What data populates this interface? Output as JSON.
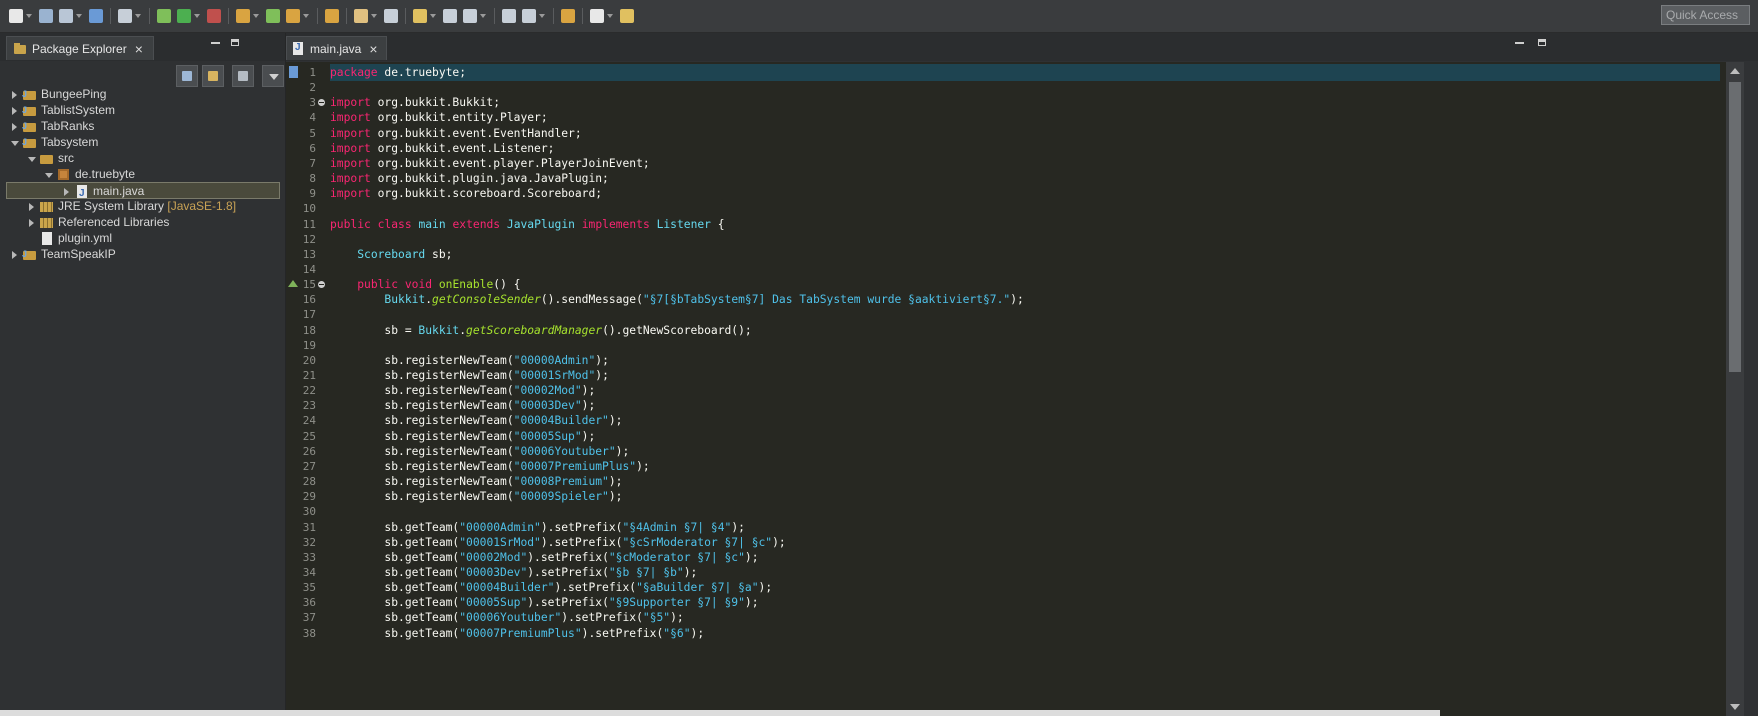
{
  "toolbar": {
    "quick_access_placeholder": "Quick Access",
    "icons": [
      "new-icon",
      "save-icon",
      "save-all-icon",
      "terminal-icon",
      "skip-breakpoints-icon",
      "debug-icon",
      "run-icon",
      "external-tools-icon",
      "new-java-project-icon",
      "new-class-icon",
      "open-type-icon",
      "open-task-icon",
      "search-icon",
      "annotation-icon",
      "mark-occurrences-icon",
      "block-selection-icon",
      "show-whitespace-icon",
      "next-annotation-icon",
      "prev-annotation-icon",
      "last-edit-icon",
      "back-icon",
      "forward-icon"
    ]
  },
  "package_explorer": {
    "tab_label": "Package Explorer",
    "tree": [
      {
        "label": "BungeePing",
        "icon": "java-project-icon",
        "level": 0,
        "state": "closed"
      },
      {
        "label": "TablistSystem",
        "icon": "java-project-icon",
        "level": 0,
        "state": "closed"
      },
      {
        "label": "TabRanks",
        "icon": "java-project-icon",
        "level": 0,
        "state": "closed"
      },
      {
        "label": "Tabsystem",
        "icon": "java-project-icon",
        "level": 0,
        "state": "open"
      },
      {
        "label": "src",
        "icon": "source-folder-icon",
        "level": 1,
        "state": "open"
      },
      {
        "label": "de.truebyte",
        "icon": "package-icon",
        "level": 2,
        "state": "open"
      },
      {
        "label": "main.java",
        "icon": "java-file-icon",
        "level": 3,
        "state": "closed",
        "selected": true
      },
      {
        "label": "JRE System Library",
        "decoration": "[JavaSE-1.8]",
        "icon": "library-icon",
        "level": 1,
        "state": "closed"
      },
      {
        "label": "Referenced Libraries",
        "icon": "library-icon",
        "level": 1,
        "state": "closed"
      },
      {
        "label": "plugin.yml",
        "icon": "yml-file-icon",
        "level": 1,
        "state": "none"
      },
      {
        "label": "TeamSpeakIP",
        "icon": "java-project-icon",
        "level": 0,
        "state": "closed"
      }
    ]
  },
  "editor": {
    "tab_label": "main.java",
    "current_line": 1,
    "lines": [
      {
        "n": "1",
        "tokens": [
          [
            "kw",
            "package"
          ],
          [
            "p",
            " de.truebyte;"
          ]
        ]
      },
      {
        "n": "2",
        "tokens": []
      },
      {
        "n": "3",
        "fold": true,
        "tokens": [
          [
            "kw",
            "import"
          ],
          [
            "p",
            " org.bukkit.Bukkit;"
          ]
        ]
      },
      {
        "n": "4",
        "tokens": [
          [
            "kw",
            "import"
          ],
          [
            "p",
            " org.bukkit.entity.Player;"
          ]
        ]
      },
      {
        "n": "5",
        "tokens": [
          [
            "kw",
            "import"
          ],
          [
            "p",
            " org.bukkit.event.EventHandler;"
          ]
        ]
      },
      {
        "n": "6",
        "tokens": [
          [
            "kw",
            "import"
          ],
          [
            "p",
            " org.bukkit.event.Listener;"
          ]
        ]
      },
      {
        "n": "7",
        "tokens": [
          [
            "kw",
            "import"
          ],
          [
            "p",
            " org.bukkit.event.player.PlayerJoinEvent;"
          ]
        ]
      },
      {
        "n": "8",
        "tokens": [
          [
            "kw",
            "import"
          ],
          [
            "p",
            " org.bukkit.plugin.java.JavaPlugin;"
          ]
        ]
      },
      {
        "n": "9",
        "tokens": [
          [
            "kw",
            "import"
          ],
          [
            "p",
            " org.bukkit.scoreboard.Scoreboard;"
          ]
        ]
      },
      {
        "n": "10",
        "tokens": []
      },
      {
        "n": "11",
        "tokens": [
          [
            "kw",
            "public"
          ],
          [
            "p",
            " "
          ],
          [
            "kw",
            "class"
          ],
          [
            "p",
            " "
          ],
          [
            "ty",
            "main"
          ],
          [
            "p",
            " "
          ],
          [
            "kw",
            "extends"
          ],
          [
            "p",
            " "
          ],
          [
            "ty",
            "JavaPlugin"
          ],
          [
            "p",
            " "
          ],
          [
            "kw",
            "implements"
          ],
          [
            "p",
            " "
          ],
          [
            "ty",
            "Listener"
          ],
          [
            "p",
            " {"
          ]
        ]
      },
      {
        "n": "12",
        "tokens": []
      },
      {
        "n": "13",
        "tokens": [
          [
            "p",
            "    "
          ],
          [
            "ty",
            "Scoreboard"
          ],
          [
            "p",
            " sb;"
          ]
        ]
      },
      {
        "n": "14",
        "tokens": []
      },
      {
        "n": "15",
        "fold": true,
        "override": true,
        "tokens": [
          [
            "p",
            "    "
          ],
          [
            "kw",
            "public"
          ],
          [
            "p",
            " "
          ],
          [
            "kw",
            "void"
          ],
          [
            "p",
            " "
          ],
          [
            "fn",
            "onEnable"
          ],
          [
            "p",
            "() {"
          ]
        ]
      },
      {
        "n": "16",
        "tokens": [
          [
            "p",
            "        "
          ],
          [
            "ty",
            "Bukkit"
          ],
          [
            "p",
            "."
          ],
          [
            "it",
            "getConsoleSender"
          ],
          [
            "p",
            "().sendMessage("
          ],
          [
            "st2",
            "\"§7[§bTabSystem§7] Das TabSystem wurde §aaktiviert§7.\""
          ],
          [
            "p",
            ");"
          ]
        ]
      },
      {
        "n": "17",
        "tokens": []
      },
      {
        "n": "18",
        "tokens": [
          [
            "p",
            "        sb = "
          ],
          [
            "ty",
            "Bukkit"
          ],
          [
            "p",
            "."
          ],
          [
            "it",
            "getScoreboardManager"
          ],
          [
            "p",
            "().getNewScoreboard();"
          ]
        ]
      },
      {
        "n": "19",
        "tokens": []
      },
      {
        "n": "20",
        "tokens": [
          [
            "p",
            "        sb.registerNewTeam("
          ],
          [
            "st2",
            "\"00000Admin\""
          ],
          [
            "p",
            ");"
          ]
        ]
      },
      {
        "n": "21",
        "tokens": [
          [
            "p",
            "        sb.registerNewTeam("
          ],
          [
            "st2",
            "\"00001SrMod\""
          ],
          [
            "p",
            ");"
          ]
        ]
      },
      {
        "n": "22",
        "tokens": [
          [
            "p",
            "        sb.registerNewTeam("
          ],
          [
            "st2",
            "\"00002Mod\""
          ],
          [
            "p",
            ");"
          ]
        ]
      },
      {
        "n": "23",
        "tokens": [
          [
            "p",
            "        sb.registerNewTeam("
          ],
          [
            "st2",
            "\"00003Dev\""
          ],
          [
            "p",
            ");"
          ]
        ]
      },
      {
        "n": "24",
        "tokens": [
          [
            "p",
            "        sb.registerNewTeam("
          ],
          [
            "st2",
            "\"00004Builder\""
          ],
          [
            "p",
            ");"
          ]
        ]
      },
      {
        "n": "25",
        "tokens": [
          [
            "p",
            "        sb.registerNewTeam("
          ],
          [
            "st2",
            "\"00005Sup\""
          ],
          [
            "p",
            ");"
          ]
        ]
      },
      {
        "n": "26",
        "tokens": [
          [
            "p",
            "        sb.registerNewTeam("
          ],
          [
            "st2",
            "\"00006Youtuber\""
          ],
          [
            "p",
            ");"
          ]
        ]
      },
      {
        "n": "27",
        "tokens": [
          [
            "p",
            "        sb.registerNewTeam("
          ],
          [
            "st2",
            "\"00007PremiumPlus\""
          ],
          [
            "p",
            ");"
          ]
        ]
      },
      {
        "n": "28",
        "tokens": [
          [
            "p",
            "        sb.registerNewTeam("
          ],
          [
            "st2",
            "\"00008Premium\""
          ],
          [
            "p",
            ");"
          ]
        ]
      },
      {
        "n": "29",
        "tokens": [
          [
            "p",
            "        sb.registerNewTeam("
          ],
          [
            "st2",
            "\"00009Spieler\""
          ],
          [
            "p",
            ");"
          ]
        ]
      },
      {
        "n": "30",
        "tokens": []
      },
      {
        "n": "31",
        "tokens": [
          [
            "p",
            "        sb.getTeam("
          ],
          [
            "st2",
            "\"00000Admin\""
          ],
          [
            "p",
            ").setPrefix("
          ],
          [
            "st2",
            "\"§4Admin §7| §4\""
          ],
          [
            "p",
            ");"
          ]
        ]
      },
      {
        "n": "32",
        "tokens": [
          [
            "p",
            "        sb.getTeam("
          ],
          [
            "st2",
            "\"00001SrMod\""
          ],
          [
            "p",
            ").setPrefix("
          ],
          [
            "st2",
            "\"§cSrModerator §7| §c\""
          ],
          [
            "p",
            ");"
          ]
        ]
      },
      {
        "n": "33",
        "tokens": [
          [
            "p",
            "        sb.getTeam("
          ],
          [
            "st2",
            "\"00002Mod\""
          ],
          [
            "p",
            ").setPrefix("
          ],
          [
            "st2",
            "\"§cModerator §7| §c\""
          ],
          [
            "p",
            ");"
          ]
        ]
      },
      {
        "n": "34",
        "tokens": [
          [
            "p",
            "        sb.getTeam("
          ],
          [
            "st2",
            "\"00003Dev\""
          ],
          [
            "p",
            ").setPrefix("
          ],
          [
            "st2",
            "\"§b §7| §b\""
          ],
          [
            "p",
            ");"
          ]
        ]
      },
      {
        "n": "35",
        "tokens": [
          [
            "p",
            "        sb.getTeam("
          ],
          [
            "st2",
            "\"00004Builder\""
          ],
          [
            "p",
            ").setPrefix("
          ],
          [
            "st2",
            "\"§aBuilder §7| §a\""
          ],
          [
            "p",
            ");"
          ]
        ]
      },
      {
        "n": "36",
        "tokens": [
          [
            "p",
            "        sb.getTeam("
          ],
          [
            "st2",
            "\"00005Sup\""
          ],
          [
            "p",
            ").setPrefix("
          ],
          [
            "st2",
            "\"§9Supporter §7| §9\""
          ],
          [
            "p",
            ");"
          ]
        ]
      },
      {
        "n": "37",
        "tokens": [
          [
            "p",
            "        sb.getTeam("
          ],
          [
            "st2",
            "\"00006Youtuber\""
          ],
          [
            "p",
            ").setPrefix("
          ],
          [
            "st2",
            "\"§5\""
          ],
          [
            "p",
            ");"
          ]
        ]
      },
      {
        "n": "38",
        "tokens": [
          [
            "p",
            "        sb.getTeam("
          ],
          [
            "st2",
            "\"00007PremiumPlus\""
          ],
          [
            "p",
            ").setPrefix("
          ],
          [
            "st2",
            "\"§6\""
          ],
          [
            "p",
            ");"
          ]
        ]
      }
    ]
  },
  "colors": {
    "keyword": "#f92672",
    "type": "#66d9ef",
    "method": "#a6e22e",
    "string": "#4fc1e9",
    "editor_bg": "#272822",
    "current_line_bg": "#1e4451"
  }
}
